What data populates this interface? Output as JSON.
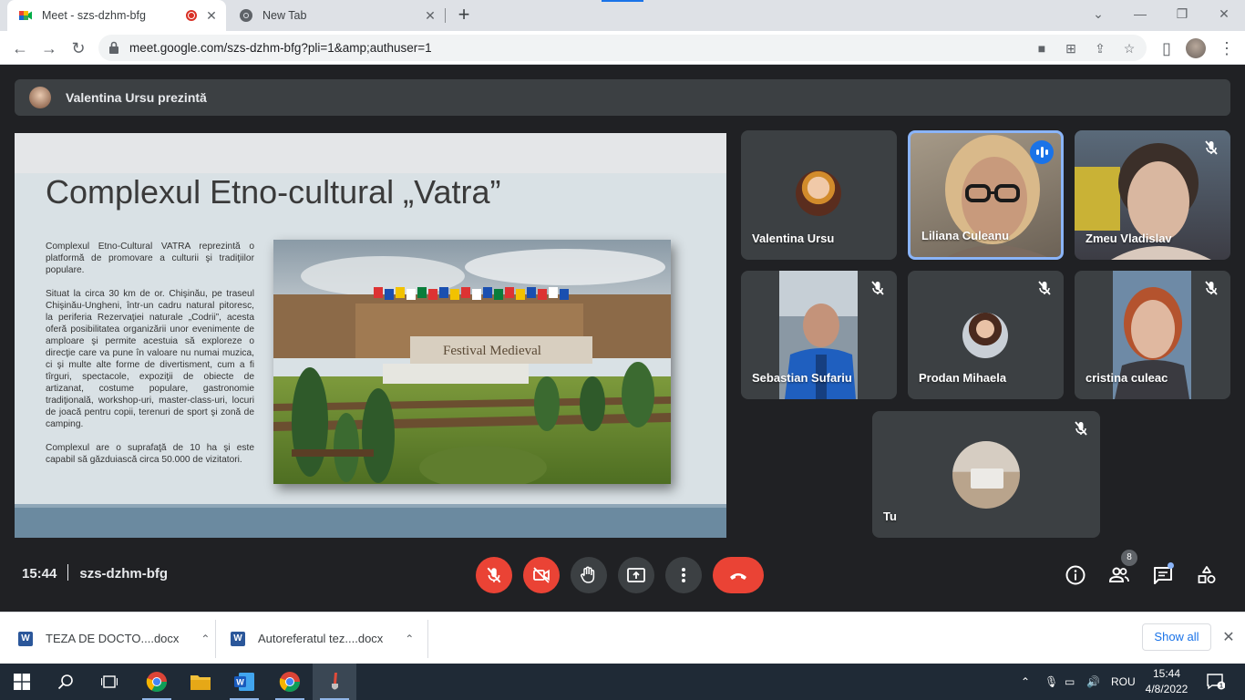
{
  "browser": {
    "tabs": [
      {
        "title": "Meet - szs-dzhm-bfg",
        "active": true
      },
      {
        "title": "New Tab",
        "active": false
      }
    ],
    "url": "meet.google.com/szs-dzhm-bfg?pli=1&amp;authuser=1"
  },
  "meet": {
    "presenter_banner": "Valentina Ursu prezintă",
    "slide": {
      "title": "Complexul Etno-cultural „Vatra”",
      "paragraphs": [
        "Complexul Etno-Cultural VATRA reprezintă o platformă de promovare a culturii şi tradiţiilor populare.",
        "Situat la circa 30 km de or. Chişinău, pe traseul Chişinău-Ungheni, într-un cadru natural pitoresc, la periferia Rezervaţiei naturale „Codrii”, acesta oferă posibilitatea organizării unor evenimente de amploare şi permite acestuia să exploreze o direcţie care va pune în valoare nu numai muzica, ci şi multe alte forme de divertisment, cum a fi tîrguri, spectacole, expoziţii de obiecte de artizanat, costume populare, gastronomie tradiţională, workshop-uri, master-class-uri, locuri de joacă pentru copii, terenuri de sport şi zonă de camping.",
        "Complexul are o suprafaţă de 10 ha şi este capabil să găzduiască circa 50.000 de vizitatori."
      ],
      "photo_sign": "Festival Medieval"
    },
    "participants": [
      {
        "name": "Valentina Ursu",
        "muted": false
      },
      {
        "name": "Liliana Culeanu",
        "speaking": true
      },
      {
        "name": "Zmeu Vladislav",
        "muted": true
      },
      {
        "name": "Sebastian Sufariu",
        "muted": true
      },
      {
        "name": "Prodan Mihaela",
        "muted": true
      },
      {
        "name": "cristina culeac",
        "muted": true
      },
      {
        "name": "Tu",
        "muted": true
      }
    ],
    "time": "15:44",
    "meeting_code": "szs-dzhm-bfg",
    "participant_count": "8",
    "accent": "#ea4335"
  },
  "downloads": {
    "items": [
      "TEZA DE DOCTO....docx",
      "Autoreferatul tez....docx"
    ],
    "show_all": "Show all"
  },
  "taskbar": {
    "language": "ROU",
    "time": "15:44",
    "date": "4/8/2022",
    "notifications": "1"
  }
}
